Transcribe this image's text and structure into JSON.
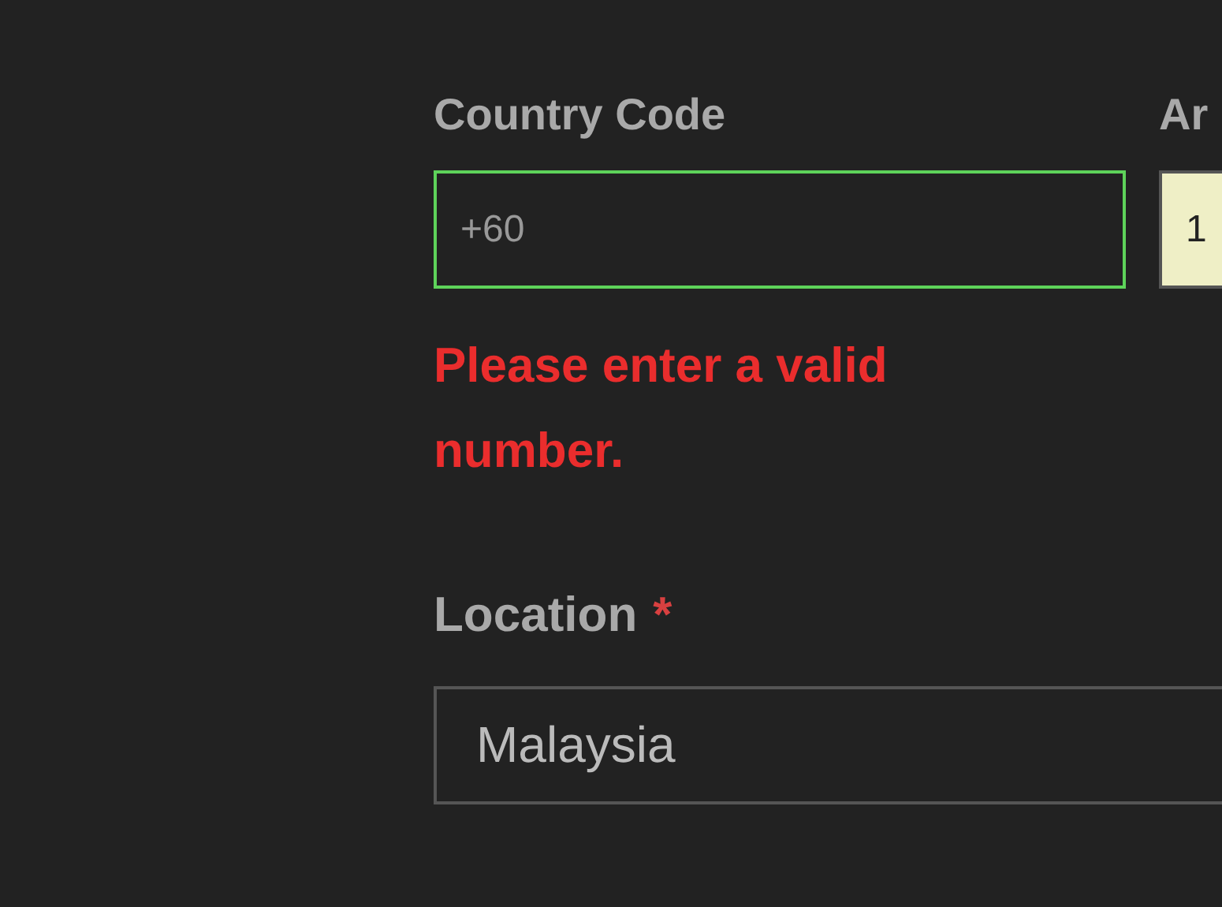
{
  "phone": [
    {
      "label": "Country Code",
      "value": "+60",
      "kind": "valid"
    },
    {
      "label": "Ar",
      "value": "1",
      "kind": "highlight"
    }
  ],
  "error": "Please enter a valid number.",
  "location": {
    "label": "Location",
    "required_mark": "*",
    "value": "Malaysia"
  }
}
